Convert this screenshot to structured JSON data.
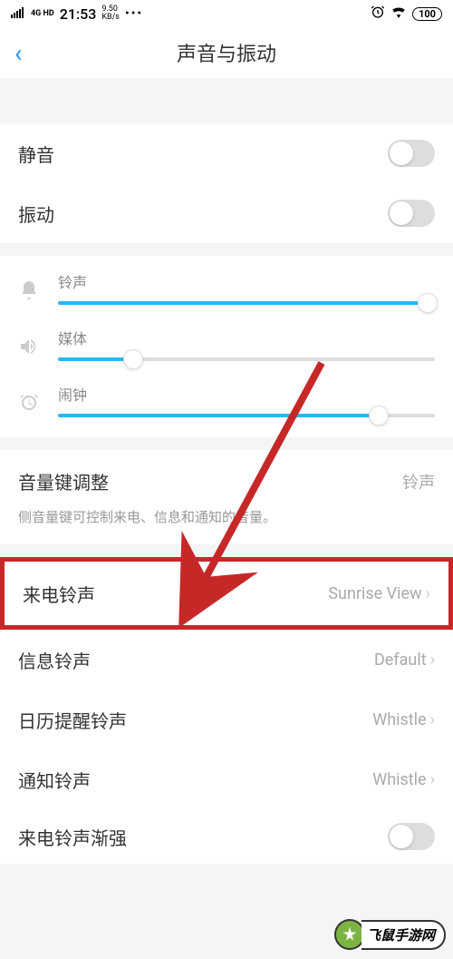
{
  "status_bar": {
    "signal_label": "4G HD",
    "time": "21:53",
    "speed_value": "9.50",
    "speed_unit": "KB/s",
    "dots": "•••",
    "battery": "100"
  },
  "header": {
    "back_glyph": "‹",
    "title": "声音与振动"
  },
  "toggles": {
    "mute": "静音",
    "vibrate": "振动"
  },
  "sliders": {
    "ringtone": {
      "label": "铃声",
      "value": 98
    },
    "media": {
      "label": "媒体",
      "value": 20
    },
    "alarm": {
      "label": "闹钟",
      "value": 85
    }
  },
  "volume_key": {
    "label": "音量键调整",
    "value": "铃声",
    "description": "侧音量键可控制来电、信息和通知的音量。"
  },
  "ringtones": {
    "incoming": {
      "label": "来电铃声",
      "value": "Sunrise View"
    },
    "message": {
      "label": "信息铃声",
      "value": "Default"
    },
    "calendar": {
      "label": "日历提醒铃声",
      "value": "Whistle"
    },
    "notification": {
      "label": "通知铃声",
      "value": "Whistle"
    },
    "gradual": {
      "label": "来电铃声渐强"
    }
  },
  "watermark": {
    "icon": "✦",
    "text": "飞鼠手游网"
  }
}
